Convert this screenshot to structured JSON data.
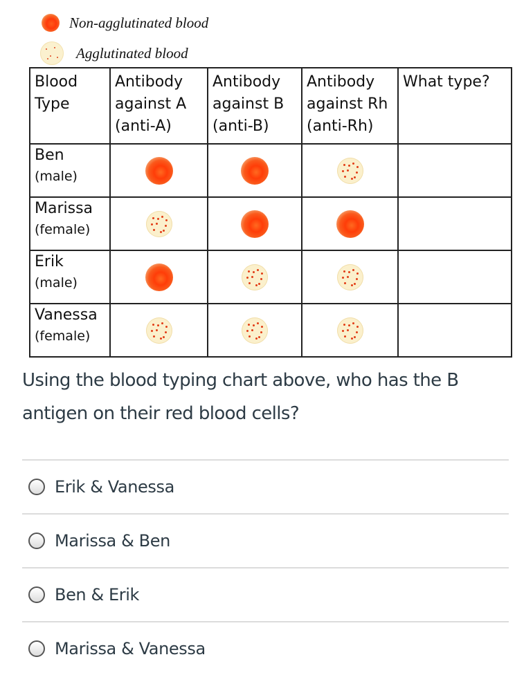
{
  "legend": {
    "items": [
      {
        "label": "Non-agglutinated blood",
        "icon": "non-agglutinated-blood-icon"
      },
      {
        "label": "Agglutinated blood",
        "icon": "agglutinated-blood-icon"
      }
    ]
  },
  "table": {
    "headers": [
      {
        "line1": "Blood",
        "line2": "Type",
        "line3": ""
      },
      {
        "line1": "Antibody",
        "line2": "against A",
        "line3": "(anti-A)"
      },
      {
        "line1": "Antibody",
        "line2": "against B",
        "line3": "(anti-B)"
      },
      {
        "line1": "Antibody",
        "line2": "against Rh",
        "line3": "(anti-Rh)"
      },
      {
        "line1": "What type?",
        "line2": "",
        "line3": ""
      }
    ],
    "rows": [
      {
        "name": "Ben",
        "sex": "(male)",
        "anti_a": "non-agglutinated",
        "anti_b": "non-agglutinated",
        "anti_rh": "agglutinated",
        "type": ""
      },
      {
        "name": "Marissa",
        "sex": "(female)",
        "anti_a": "agglutinated",
        "anti_b": "non-agglutinated",
        "anti_rh": "non-agglutinated",
        "type": ""
      },
      {
        "name": "Erik",
        "sex": "(male)",
        "anti_a": "non-agglutinated",
        "anti_b": "agglutinated",
        "anti_rh": "agglutinated",
        "type": ""
      },
      {
        "name": "Vanessa",
        "sex": "(female)",
        "anti_a": "agglutinated",
        "anti_b": "agglutinated",
        "anti_rh": "agglutinated",
        "type": ""
      }
    ]
  },
  "question": {
    "text": "Using the blood typing chart above, who has the B antigen on their red blood cells?"
  },
  "answers": [
    {
      "label": "Erik & Vanessa",
      "selected": false
    },
    {
      "label": "Marissa & Ben",
      "selected": false
    },
    {
      "label": "Ben & Erik",
      "selected": false
    },
    {
      "label": "Marissa & Vanessa",
      "selected": false
    }
  ],
  "colors": {
    "text": "#2d3b45",
    "divider": "#dcdcdc",
    "blood_red": "#ff3d08",
    "agglutinated_bg": "#fbf0cc"
  }
}
